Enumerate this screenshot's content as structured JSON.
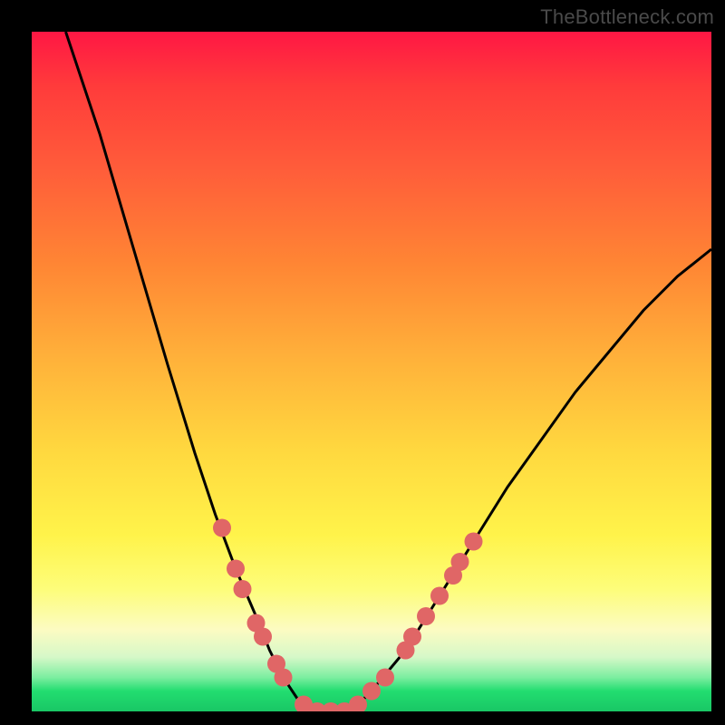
{
  "watermark": "TheBottleneck.com",
  "chart_data": {
    "type": "line",
    "title": "",
    "xlabel": "",
    "ylabel": "",
    "xlim": [
      0,
      100
    ],
    "ylim": [
      0,
      100
    ],
    "series": [
      {
        "name": "bottleneck-curve",
        "x": [
          5,
          10,
          15,
          20,
          24,
          27,
          30,
          33,
          35,
          37,
          39,
          40,
          42,
          44,
          46,
          48,
          50,
          55,
          60,
          65,
          70,
          75,
          80,
          85,
          90,
          95,
          100
        ],
        "values": [
          100,
          85,
          68,
          51,
          38,
          29,
          21,
          14,
          9,
          5,
          2,
          1,
          0,
          0,
          0,
          1,
          3,
          9,
          17,
          25,
          33,
          40,
          47,
          53,
          59,
          64,
          68
        ]
      }
    ],
    "markers": [
      {
        "x": 28,
        "y": 27
      },
      {
        "x": 30,
        "y": 21
      },
      {
        "x": 31,
        "y": 18
      },
      {
        "x": 33,
        "y": 13
      },
      {
        "x": 34,
        "y": 11
      },
      {
        "x": 36,
        "y": 7
      },
      {
        "x": 37,
        "y": 5
      },
      {
        "x": 40,
        "y": 1
      },
      {
        "x": 42,
        "y": 0
      },
      {
        "x": 44,
        "y": 0
      },
      {
        "x": 46,
        "y": 0
      },
      {
        "x": 48,
        "y": 1
      },
      {
        "x": 50,
        "y": 3
      },
      {
        "x": 52,
        "y": 5
      },
      {
        "x": 55,
        "y": 9
      },
      {
        "x": 56,
        "y": 11
      },
      {
        "x": 58,
        "y": 14
      },
      {
        "x": 60,
        "y": 17
      },
      {
        "x": 62,
        "y": 20
      },
      {
        "x": 63,
        "y": 22
      },
      {
        "x": 65,
        "y": 25
      }
    ],
    "marker_color": "#e06666",
    "marker_radius": 10,
    "curve_color": "#000000",
    "curve_width": 3
  }
}
